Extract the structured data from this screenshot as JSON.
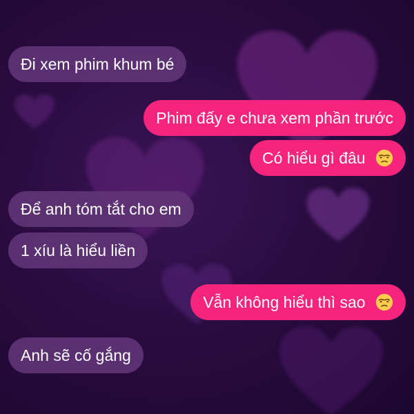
{
  "conversation": {
    "messages": [
      {
        "sender": "other",
        "text": "Đi xem phim khum bé"
      },
      {
        "sender": "me",
        "text": "Phim đấy e chưa xem phần trước"
      },
      {
        "sender": "me",
        "text": "Có hiểu gì đâu",
        "emoji": "unamused-face-icon"
      },
      {
        "sender": "other",
        "text": "Để anh tóm tắt cho em"
      },
      {
        "sender": "other",
        "text": "1 xíu là hiểu liền"
      },
      {
        "sender": "me",
        "text": "Vẫn không hiểu thì sao",
        "emoji": "unamused-face-icon"
      },
      {
        "sender": "other",
        "text": "Anh sẽ cố gắng"
      }
    ]
  },
  "theme": {
    "background": "#2a0c40",
    "incoming_bubble": "#603476",
    "outgoing_bubble": "#f5247c",
    "text": "#ffffff"
  }
}
